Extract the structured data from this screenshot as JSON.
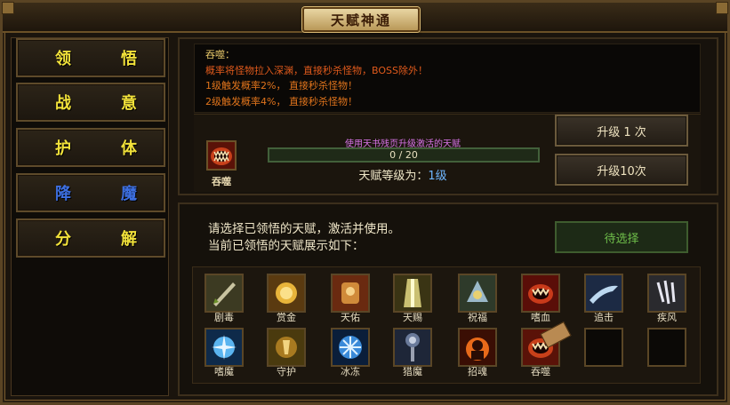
{
  "window": {
    "title": "天赋神通"
  },
  "menu": {
    "items": [
      {
        "label_a": "领",
        "label_b": "悟"
      },
      {
        "label_a": "战",
        "label_b": "意"
      },
      {
        "label_a": "护",
        "label_b": "体"
      },
      {
        "label_a": "降",
        "label_b": "魔"
      },
      {
        "label_a": "分",
        "label_b": "解"
      }
    ],
    "active_index": 3
  },
  "talent": {
    "name": "吞噬",
    "desc": [
      "吞噬：",
      "概率将怪物拉入深渊，直接秒杀怪物，BOSS除外！",
      "1级触发概率2%， 直接秒杀怪物！",
      "2级触发概率4%， 直接秒杀怪物！"
    ],
    "hint": "使用天书残页升级激活的天赋",
    "progress_text": "0 / 20",
    "progress": 0,
    "level_label": "天赋等级为：",
    "level_value": "1级",
    "icon": "devour-maw-icon"
  },
  "buttons": {
    "upgrade_once": "升级 1 次",
    "upgrade_ten": "升级10次",
    "pending": "待选择"
  },
  "select": {
    "line1": "请选择已领悟的天赋，激活并使用。",
    "line2": "当前已领悟的天赋展示如下："
  },
  "grid": {
    "row1": [
      {
        "label": "剧毒",
        "icon": "poison-blade-icon"
      },
      {
        "label": "赏金",
        "icon": "gold-reward-icon"
      },
      {
        "label": "天佑",
        "icon": "divine-blessing-icon"
      },
      {
        "label": "天赐",
        "icon": "heaven-gift-icon"
      },
      {
        "label": "祝福",
        "icon": "blessing-icon"
      },
      {
        "label": "嗜血",
        "icon": "bloodthirst-icon"
      },
      {
        "label": "追击",
        "icon": "pursuit-icon"
      },
      {
        "label": "疾风",
        "icon": "gale-icon"
      }
    ],
    "row2": [
      {
        "label": "嗜魔",
        "icon": "demon-hunger-icon"
      },
      {
        "label": "守护",
        "icon": "guardian-icon"
      },
      {
        "label": "冰冻",
        "icon": "freeze-icon"
      },
      {
        "label": "猎魔",
        "icon": "demon-hunt-icon"
      },
      {
        "label": "招魂",
        "icon": "soul-summon-icon"
      },
      {
        "label": "吞噬",
        "icon": "devour-icon"
      },
      {
        "label": "",
        "icon": "empty-slot"
      },
      {
        "label": "",
        "icon": "empty-slot"
      }
    ]
  },
  "colors": {
    "menu_text": "#f2e23a",
    "menu_active": "#3d6fe0",
    "desc_title": "#e8c86a",
    "desc_text": "#e0741c",
    "hint": "#d874e8",
    "level_value": "#6fb7ff",
    "pending": "#6fbf4a"
  }
}
